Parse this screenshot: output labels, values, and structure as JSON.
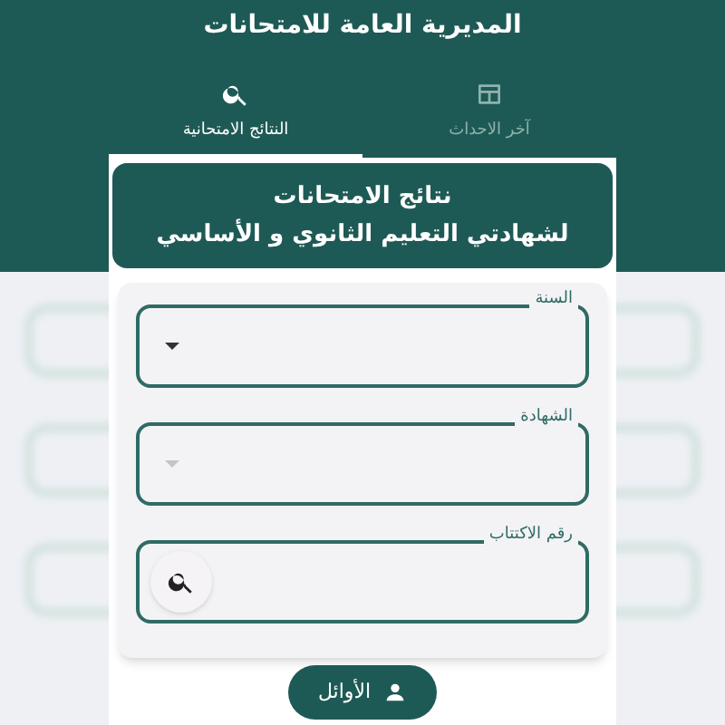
{
  "app_bar": {
    "title": "المديرية العامة للامتحانات"
  },
  "tabs": [
    {
      "label": "آخر الاحداث",
      "selected": false
    },
    {
      "label": "النتائج الامتحانية",
      "selected": true
    }
  ],
  "banner": {
    "lines": [
      "نتائج الامتحانات",
      "لشهادتي التعليم الثانوي و الأساسي"
    ]
  },
  "fields": [
    {
      "label": "السنة",
      "kind": "dropdown",
      "disabled": false
    },
    {
      "label": "الشهادة",
      "kind": "dropdown",
      "disabled": true
    },
    {
      "label": "رقم الاكتتاب",
      "kind": "search",
      "disabled": false
    }
  ],
  "bottom_button": {
    "label": "الأوائل"
  }
}
